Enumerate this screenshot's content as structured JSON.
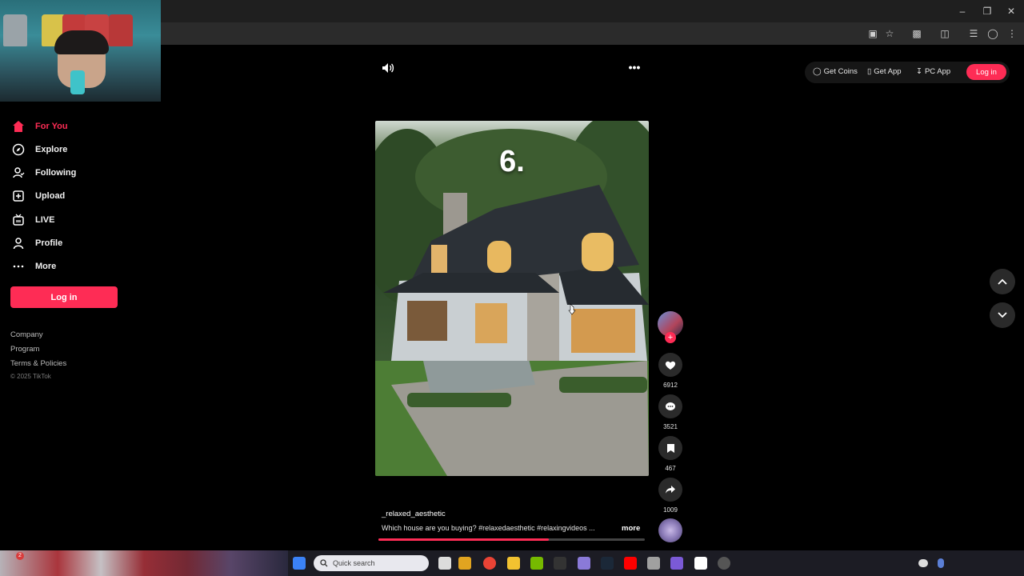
{
  "browser": {
    "window_controls": [
      "minimize",
      "restore",
      "close"
    ]
  },
  "sidebar": {
    "items": [
      {
        "label": "For You",
        "icon": "home-icon",
        "active": true
      },
      {
        "label": "Explore",
        "icon": "compass-icon",
        "active": false
      },
      {
        "label": "Following",
        "icon": "following-icon",
        "active": false
      },
      {
        "label": "Upload",
        "icon": "upload-icon",
        "active": false
      },
      {
        "label": "LIVE",
        "icon": "live-icon",
        "active": false
      },
      {
        "label": "Profile",
        "icon": "profile-icon",
        "active": false
      },
      {
        "label": "More",
        "icon": "more-dots-icon",
        "active": false
      }
    ],
    "login_label": "Log in",
    "footer_links": [
      "Company",
      "Program",
      "Terms & Policies"
    ],
    "copyright": "© 2025 TikTok"
  },
  "topbar": {
    "get_coins": "Get Coins",
    "get_app": "Get App",
    "pc_app": "PC App",
    "login": "Log in"
  },
  "video": {
    "overlay_text": "6.",
    "username": "_relaxed_aesthetic",
    "caption": "Which house are you buying? #relaxedaesthetic  #relaxingvideos ...",
    "more_label": "more",
    "progress_fraction": 0.64
  },
  "actions": {
    "likes": "6912",
    "comments": "3521",
    "saves": "467",
    "shares": "1009"
  },
  "taskbar": {
    "search_placeholder": "Quick search",
    "weather_temp": "",
    "notification_count": "2"
  },
  "colors": {
    "accent": "#fe2c55",
    "background": "#000000",
    "button_bg": "#2a2a2a"
  }
}
